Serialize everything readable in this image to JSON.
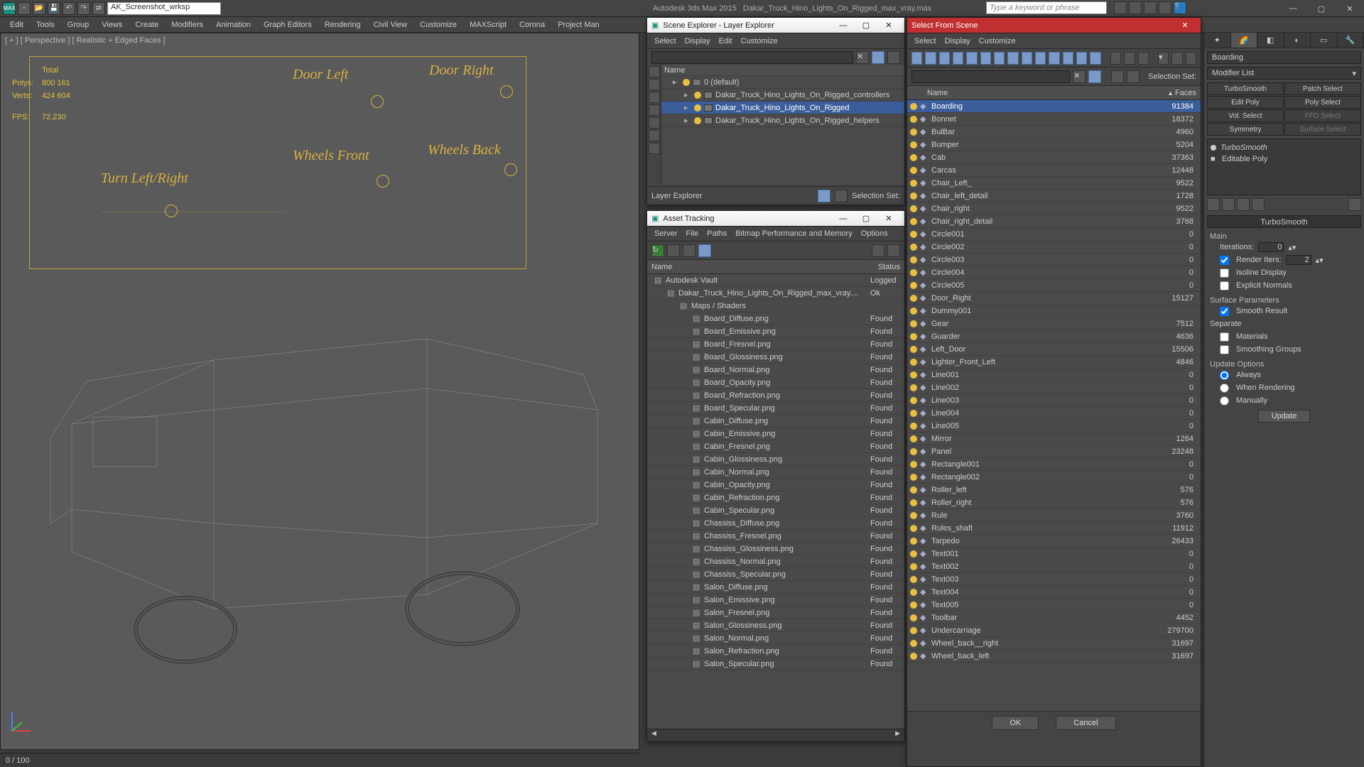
{
  "app": {
    "title_left": "Autodesk 3ds Max  2015",
    "title_right": "Dakar_Truck_Hino_Lights_On_Rigged_max_vray.max",
    "workspace": "AK_Screenshot_wrksp",
    "search_placeholder": "Type a keyword or phrase"
  },
  "menubar": [
    "Edit",
    "Tools",
    "Group",
    "Views",
    "Create",
    "Modifiers",
    "Animation",
    "Graph Editors",
    "Rendering",
    "Civil View",
    "Customize",
    "MAXScript",
    "Corona",
    "Project Man"
  ],
  "viewport": {
    "label": "[ + ] [ Perspective ] [ Realistic + Edged Faces ]",
    "stats": {
      "total": "Total",
      "polys_l": "Polys:",
      "polys": "800 161",
      "verts_l": "Verts:",
      "verts": "424 604",
      "fps_l": "FPS:",
      "fps": "72,230"
    },
    "rig": {
      "door_left": "Door Left",
      "door_right": "Door Right",
      "wheels_front": "Wheels Front",
      "wheels_back": "Wheels Back",
      "turn": "Turn   Left/Right"
    },
    "timeline": "0 / 100"
  },
  "scene_explorer": {
    "title": "Scene Explorer - Layer Explorer",
    "menus": [
      "Select",
      "Display",
      "Edit",
      "Customize"
    ],
    "name_col": "Name",
    "bottom_label": "Layer Explorer",
    "sel_set": "Selection Set:",
    "tree": [
      {
        "name": "0 (default)",
        "indent": 0,
        "sel": false
      },
      {
        "name": "Dakar_Truck_Hino_Lights_On_Rigged_controllers",
        "indent": 1,
        "sel": false
      },
      {
        "name": "Dakar_Truck_Hino_Lights_On_Rigged",
        "indent": 1,
        "sel": true
      },
      {
        "name": "Dakar_Truck_Hino_Lights_On_Rigged_helpers",
        "indent": 1,
        "sel": false
      }
    ]
  },
  "asset_tracking": {
    "title": "Asset Tracking",
    "menus": [
      "Server",
      "File",
      "Paths",
      "Bitmap Performance and Memory",
      "Options"
    ],
    "cols": {
      "name": "Name",
      "status": "Status"
    },
    "rows": [
      {
        "name": "Autodesk Vault",
        "status": "Logged",
        "indent": 0,
        "ico": "vault"
      },
      {
        "name": "Dakar_Truck_Hino_Lights_On_Rigged_max_vray....",
        "status": "Ok",
        "indent": 1,
        "ico": "file"
      },
      {
        "name": "Maps / Shaders",
        "status": "",
        "indent": 2,
        "ico": "folder"
      },
      {
        "name": "Board_Diffuse.png",
        "status": "Found",
        "indent": 3,
        "ico": "img"
      },
      {
        "name": "Board_Emissive.png",
        "status": "Found",
        "indent": 3,
        "ico": "img"
      },
      {
        "name": "Board_Fresnel.png",
        "status": "Found",
        "indent": 3,
        "ico": "img"
      },
      {
        "name": "Board_Glossiness.png",
        "status": "Found",
        "indent": 3,
        "ico": "img"
      },
      {
        "name": "Board_Normal.png",
        "status": "Found",
        "indent": 3,
        "ico": "img"
      },
      {
        "name": "Board_Opacity.png",
        "status": "Found",
        "indent": 3,
        "ico": "img"
      },
      {
        "name": "Board_Refraction.png",
        "status": "Found",
        "indent": 3,
        "ico": "img"
      },
      {
        "name": "Board_Specular.png",
        "status": "Found",
        "indent": 3,
        "ico": "img"
      },
      {
        "name": "Cabin_Diffuse.png",
        "status": "Found",
        "indent": 3,
        "ico": "img"
      },
      {
        "name": "Cabin_Emissive.png",
        "status": "Found",
        "indent": 3,
        "ico": "img"
      },
      {
        "name": "Cabin_Fresnel.png",
        "status": "Found",
        "indent": 3,
        "ico": "img"
      },
      {
        "name": "Cabin_Glossiness.png",
        "status": "Found",
        "indent": 3,
        "ico": "img"
      },
      {
        "name": "Cabin_Normal.png",
        "status": "Found",
        "indent": 3,
        "ico": "img"
      },
      {
        "name": "Cabin_Opacity.png",
        "status": "Found",
        "indent": 3,
        "ico": "img"
      },
      {
        "name": "Cabin_Refraction.png",
        "status": "Found",
        "indent": 3,
        "ico": "img"
      },
      {
        "name": "Cabin_Specular.png",
        "status": "Found",
        "indent": 3,
        "ico": "img"
      },
      {
        "name": "Chassiss_Diffuse.png",
        "status": "Found",
        "indent": 3,
        "ico": "img"
      },
      {
        "name": "Chassiss_Fresnel.png",
        "status": "Found",
        "indent": 3,
        "ico": "img"
      },
      {
        "name": "Chassiss_Glossiness.png",
        "status": "Found",
        "indent": 3,
        "ico": "img"
      },
      {
        "name": "Chassiss_Normal.png",
        "status": "Found",
        "indent": 3,
        "ico": "img"
      },
      {
        "name": "Chassiss_Specular.png",
        "status": "Found",
        "indent": 3,
        "ico": "img"
      },
      {
        "name": "Salon_Diffuse.png",
        "status": "Found",
        "indent": 3,
        "ico": "img"
      },
      {
        "name": "Salon_Emissive.png",
        "status": "Found",
        "indent": 3,
        "ico": "img"
      },
      {
        "name": "Salon_Fresnel.png",
        "status": "Found",
        "indent": 3,
        "ico": "img"
      },
      {
        "name": "Salon_Glossiness.png",
        "status": "Found",
        "indent": 3,
        "ico": "img"
      },
      {
        "name": "Salon_Normal.png",
        "status": "Found",
        "indent": 3,
        "ico": "img"
      },
      {
        "name": "Salon_Refraction.png",
        "status": "Found",
        "indent": 3,
        "ico": "img"
      },
      {
        "name": "Salon_Specular.png",
        "status": "Found",
        "indent": 3,
        "ico": "img"
      }
    ]
  },
  "select_from_scene": {
    "title": "Select From Scene",
    "menus": [
      "Select",
      "Display",
      "Customize"
    ],
    "cols": {
      "name": "Name",
      "faces": "Faces"
    },
    "sel_set": "Selection Set:",
    "ok": "OK",
    "cancel": "Cancel",
    "rows": [
      {
        "name": "Boarding",
        "faces": "91384",
        "sel": true
      },
      {
        "name": "Bonnet",
        "faces": "18372"
      },
      {
        "name": "BulBar",
        "faces": "4960"
      },
      {
        "name": "Bumper",
        "faces": "5204"
      },
      {
        "name": "Cab",
        "faces": "37363"
      },
      {
        "name": "Carcas",
        "faces": "12448"
      },
      {
        "name": "Chair_Left_",
        "faces": "9522"
      },
      {
        "name": "Chair_left_detail",
        "faces": "1728"
      },
      {
        "name": "Chair_right",
        "faces": "9522"
      },
      {
        "name": "Chair_right_detail",
        "faces": "3768"
      },
      {
        "name": "Circle001",
        "faces": "0"
      },
      {
        "name": "Circle002",
        "faces": "0"
      },
      {
        "name": "Circle003",
        "faces": "0"
      },
      {
        "name": "Circle004",
        "faces": "0"
      },
      {
        "name": "Circle005",
        "faces": "0"
      },
      {
        "name": "Door_Right",
        "faces": "15127"
      },
      {
        "name": "Dummy001",
        "faces": ""
      },
      {
        "name": "Gear",
        "faces": "7512"
      },
      {
        "name": "Guarder",
        "faces": "4636"
      },
      {
        "name": "Left_Door",
        "faces": "15506"
      },
      {
        "name": "Lighter_Front_Left",
        "faces": "4846"
      },
      {
        "name": "Line001",
        "faces": "0"
      },
      {
        "name": "Line002",
        "faces": "0"
      },
      {
        "name": "Line003",
        "faces": "0"
      },
      {
        "name": "Line004",
        "faces": "0"
      },
      {
        "name": "Line005",
        "faces": "0"
      },
      {
        "name": "Mirror",
        "faces": "1264"
      },
      {
        "name": "Panel",
        "faces": "23248"
      },
      {
        "name": "Rectangle001",
        "faces": "0"
      },
      {
        "name": "Rectangle002",
        "faces": "0"
      },
      {
        "name": "Roller_left",
        "faces": "576"
      },
      {
        "name": "Roller_right",
        "faces": "576"
      },
      {
        "name": "Rule",
        "faces": "3760"
      },
      {
        "name": "Rules_shaft",
        "faces": "11912"
      },
      {
        "name": "Tarpedo",
        "faces": "26433"
      },
      {
        "name": "Text001",
        "faces": "0"
      },
      {
        "name": "Text002",
        "faces": "0"
      },
      {
        "name": "Text003",
        "faces": "0"
      },
      {
        "name": "Text004",
        "faces": "0"
      },
      {
        "name": "Text005",
        "faces": "0"
      },
      {
        "name": "Toolbar",
        "faces": "4452"
      },
      {
        "name": "Undercarriage",
        "faces": "279700"
      },
      {
        "name": "Wheel_back__right",
        "faces": "31697"
      },
      {
        "name": "Wheel_back_left",
        "faces": "31697"
      }
    ]
  },
  "modify": {
    "obj_name": "Boarding",
    "mod_list_label": "Modifier List",
    "tabs": [
      "TurboSmooth",
      "Patch Select",
      "Edit Poly",
      "Poly Select",
      "Vol. Select",
      "FFD Select",
      "Symmetry",
      "Surface Select"
    ],
    "stack": [
      {
        "label": "TurboSmooth",
        "italic": true
      },
      {
        "label": "Editable Poly",
        "italic": false
      }
    ],
    "rollout_title": "TurboSmooth",
    "main": "Main",
    "iterations_l": "Iterations:",
    "iterations": "0",
    "render_iters_l": "Render Iters:",
    "render_iters": "2",
    "isoline": "Isoline Display",
    "explicit": "Explicit Normals",
    "surf_param": "Surface Parameters",
    "smooth_result": "Smooth Result",
    "separate": "Separate",
    "materials": "Materials",
    "smoothing_groups": "Smoothing Groups",
    "update_options": "Update Options",
    "always": "Always",
    "when_rendering": "When Rendering",
    "manually": "Manually",
    "update_btn": "Update"
  }
}
